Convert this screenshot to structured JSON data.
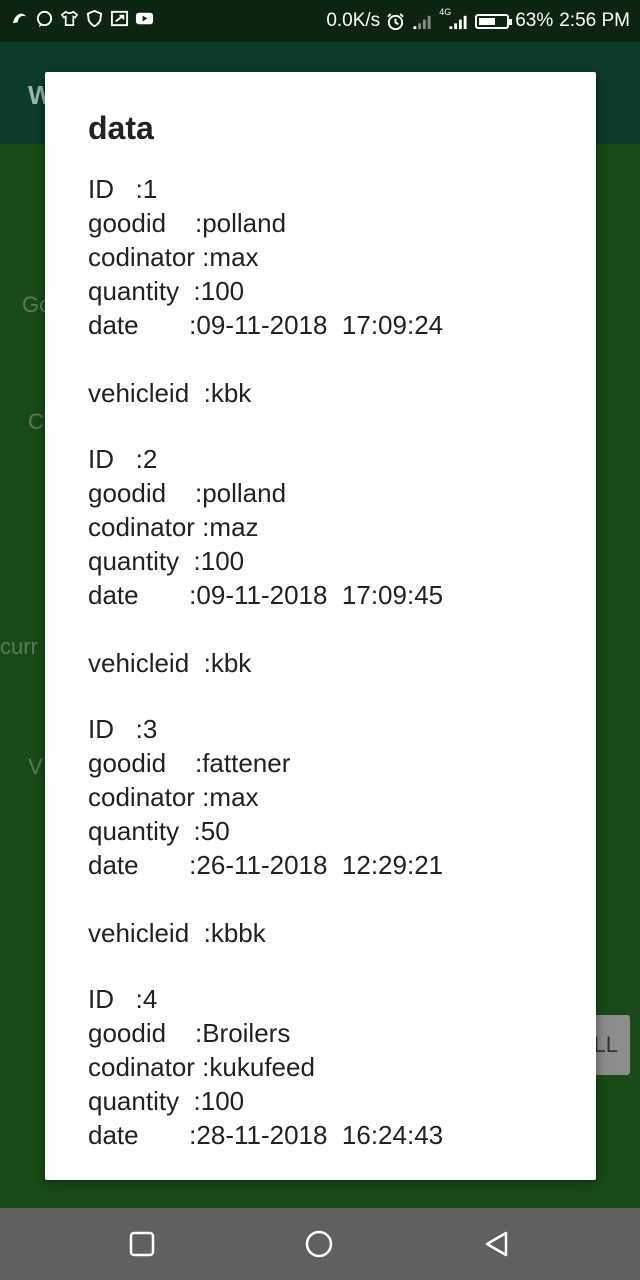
{
  "status_bar": {
    "network_speed": "0.0K/s",
    "network_type": "4G",
    "battery_percent": "63%",
    "battery_level": 0.63,
    "time": "2:56 PM",
    "left_icons": [
      "app-logo-icon",
      "message-icon",
      "shirt-icon",
      "shield-icon",
      "screenshot-icon",
      "youtube-icon"
    ]
  },
  "app": {
    "title_initial": "W",
    "bg_labels": [
      "Go",
      "C",
      "curr",
      "V"
    ],
    "button_text": "LL"
  },
  "dialog": {
    "title": "data",
    "records": [
      {
        "id_line": "ID   :1",
        "goodid_line": "goodid    :polland",
        "codinator_line": "codinator :max",
        "quantity_line": "quantity  :100",
        "date_line": "date       :09-11-2018  17:09:24",
        "vehicle_line": "vehicleid  :kbk"
      },
      {
        "id_line": "ID   :2",
        "goodid_line": "goodid    :polland",
        "codinator_line": "codinator :maz",
        "quantity_line": "quantity  :100",
        "date_line": "date       :09-11-2018  17:09:45",
        "vehicle_line": "vehicleid  :kbk"
      },
      {
        "id_line": "ID   :3",
        "goodid_line": "goodid    :fattener",
        "codinator_line": "codinator :max",
        "quantity_line": "quantity  :50",
        "date_line": "date       :26-11-2018  12:29:21",
        "vehicle_line": "vehicleid  :kbbk"
      },
      {
        "id_line": "ID   :4",
        "goodid_line": "goodid    :Broilers",
        "codinator_line": "codinator :kukufeed",
        "quantity_line": "quantity  :100",
        "date_line": "date       :28-11-2018  16:24:43",
        "vehicle_line": ""
      }
    ]
  },
  "nav_bar": {
    "buttons": [
      "recents-button",
      "home-button",
      "back-button"
    ]
  }
}
